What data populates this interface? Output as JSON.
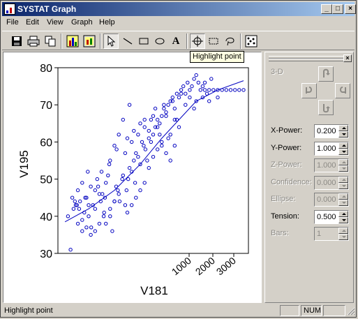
{
  "window": {
    "title": "SYSTAT Graph"
  },
  "caption_buttons": {
    "minimize": "_",
    "maximize": "□",
    "close": "×"
  },
  "menu": [
    "File",
    "Edit",
    "View",
    "Graph",
    "Help"
  ],
  "toolbar": {
    "items": [
      "save-icon",
      "print-icon",
      "copy-icon",
      "bar-chart-icon",
      "chart-properties-icon",
      "pointer-icon",
      "line-icon",
      "rectangle-icon",
      "ellipse-icon",
      "text-tool-icon",
      "highlight-point-icon",
      "select-rect-icon",
      "lasso-icon",
      "brush-icon"
    ],
    "text_tool_glyph": "A"
  },
  "tooltip": "Highlight point",
  "panel": {
    "title_3d": "3-D",
    "fields": [
      {
        "label": "X-Power:",
        "value": "0.200",
        "enabled": true
      },
      {
        "label": "Y-Power:",
        "value": "1.000",
        "enabled": true
      },
      {
        "label": "Z-Power:",
        "value": "1.000",
        "enabled": false
      },
      {
        "label": "Confidence:",
        "value": "0.000",
        "enabled": false
      },
      {
        "label": "Ellipse:",
        "value": "0.000",
        "enabled": false
      },
      {
        "label": "Tension:",
        "value": "0.500",
        "enabled": true
      },
      {
        "label": "Bars:",
        "value": "1",
        "enabled": false
      }
    ]
  },
  "status": {
    "text": "Highlight point",
    "num": "NUM"
  },
  "colors": {
    "points": "#0000c0",
    "titlebar_start": "#0a246a",
    "titlebar_end": "#a6caf0"
  },
  "chart_data": {
    "type": "scatter",
    "xlabel": "V181",
    "ylabel": "V195",
    "x_scale": "power 0.2",
    "x_ticks": [
      "1000",
      "2000",
      "3000"
    ],
    "y_ticks": [
      "30",
      "40",
      "50",
      "60",
      "70",
      "80"
    ],
    "ylim": [
      30,
      80
    ],
    "smoother": "spline, tension 0.5",
    "points": [
      [
        12,
        40
      ],
      [
        18,
        31
      ],
      [
        22,
        45
      ],
      [
        28,
        44
      ],
      [
        33,
        43
      ],
      [
        38,
        42
      ],
      [
        45,
        36
      ],
      [
        52,
        45
      ],
      [
        58,
        52
      ],
      [
        60,
        40
      ],
      [
        66,
        37
      ],
      [
        70,
        43
      ],
      [
        75,
        47
      ],
      [
        82,
        48
      ],
      [
        88,
        44
      ],
      [
        92,
        46
      ],
      [
        96,
        41
      ],
      [
        98,
        45
      ],
      [
        100,
        38
      ],
      [
        105,
        51
      ],
      [
        108,
        54
      ],
      [
        110,
        42
      ],
      [
        115,
        36
      ],
      [
        120,
        44
      ],
      [
        124,
        48
      ],
      [
        128,
        47
      ],
      [
        132,
        44
      ],
      [
        138,
        50
      ],
      [
        140,
        51
      ],
      [
        145,
        43
      ],
      [
        148,
        47
      ],
      [
        152,
        50
      ],
      [
        155,
        53
      ],
      [
        160,
        52
      ],
      [
        165,
        55
      ],
      [
        168,
        49
      ],
      [
        170,
        57
      ],
      [
        175,
        56
      ],
      [
        180,
        54
      ],
      [
        184,
        60
      ],
      [
        188,
        59
      ],
      [
        192,
        58
      ],
      [
        196,
        55
      ],
      [
        200,
        61
      ],
      [
        205,
        60
      ],
      [
        210,
        62
      ],
      [
        215,
        64
      ],
      [
        220,
        66
      ],
      [
        225,
        65
      ],
      [
        230,
        67
      ],
      [
        235,
        69
      ],
      [
        240,
        68
      ],
      [
        245,
        70
      ],
      [
        250,
        71
      ],
      [
        255,
        71
      ],
      [
        260,
        69
      ],
      [
        265,
        73
      ],
      [
        270,
        72
      ],
      [
        275,
        74
      ],
      [
        280,
        75
      ],
      [
        285,
        73
      ],
      [
        290,
        76
      ],
      [
        295,
        74
      ],
      [
        300,
        75
      ],
      [
        305,
        77
      ],
      [
        310,
        78
      ],
      [
        315,
        76
      ],
      [
        320,
        74
      ],
      [
        325,
        75
      ],
      [
        330,
        74
      ],
      [
        335,
        73
      ],
      [
        340,
        74
      ],
      [
        350,
        74
      ],
      [
        360,
        74
      ],
      [
        370,
        74
      ],
      [
        380,
        74
      ],
      [
        390,
        74
      ],
      [
        400,
        74
      ],
      [
        410,
        74
      ],
      [
        420,
        74
      ],
      [
        155,
        70
      ],
      [
        190,
        66
      ],
      [
        210,
        67
      ],
      [
        220,
        64
      ],
      [
        240,
        67
      ],
      [
        250,
        62
      ],
      [
        260,
        66
      ],
      [
        270,
        64
      ],
      [
        140,
        66
      ],
      [
        130,
        62
      ],
      [
        120,
        59
      ],
      [
        150,
        61
      ],
      [
        165,
        63
      ],
      [
        180,
        65
      ],
      [
        200,
        63
      ],
      [
        230,
        60
      ],
      [
        260,
        59
      ],
      [
        100,
        49
      ],
      [
        85,
        46
      ],
      [
        75,
        42
      ],
      [
        60,
        43
      ],
      [
        50,
        41
      ],
      [
        40,
        44
      ],
      [
        30,
        43
      ],
      [
        25,
        42
      ],
      [
        35,
        47
      ],
      [
        45,
        49
      ],
      [
        55,
        45
      ],
      [
        65,
        48
      ],
      [
        80,
        50
      ],
      [
        90,
        52
      ],
      [
        110,
        55
      ],
      [
        125,
        58
      ],
      [
        145,
        57
      ],
      [
        160,
        60
      ],
      [
        175,
        62
      ],
      [
        190,
        64
      ],
      [
        205,
        66
      ],
      [
        215,
        69
      ],
      [
        235,
        70
      ],
      [
        255,
        72
      ],
      [
        275,
        73
      ],
      [
        295,
        72
      ],
      [
        310,
        71
      ],
      [
        330,
        76
      ],
      [
        345,
        77
      ],
      [
        225,
        62
      ],
      [
        245,
        61
      ],
      [
        265,
        66
      ],
      [
        285,
        70
      ],
      [
        305,
        69
      ],
      [
        325,
        72
      ],
      [
        340,
        71
      ],
      [
        360,
        72
      ],
      [
        190,
        49
      ],
      [
        180,
        47
      ],
      [
        170,
        45
      ],
      [
        160,
        43
      ],
      [
        150,
        41
      ],
      [
        200,
        53
      ],
      [
        210,
        56
      ],
      [
        220,
        58
      ],
      [
        230,
        59
      ],
      [
        240,
        57
      ],
      [
        250,
        55
      ],
      [
        130,
        46
      ],
      [
        120,
        44
      ],
      [
        110,
        40
      ],
      [
        95,
        40
      ],
      [
        85,
        38
      ],
      [
        75,
        36
      ],
      [
        65,
        35
      ],
      [
        55,
        37
      ],
      [
        45,
        39
      ],
      [
        35,
        38
      ]
    ],
    "curve": [
      [
        5,
        38.5
      ],
      [
        60,
        42
      ],
      [
        120,
        47
      ],
      [
        180,
        54
      ],
      [
        230,
        61
      ],
      [
        270,
        66
      ],
      [
        310,
        71
      ],
      [
        360,
        74
      ],
      [
        420,
        76.5
      ]
    ]
  }
}
